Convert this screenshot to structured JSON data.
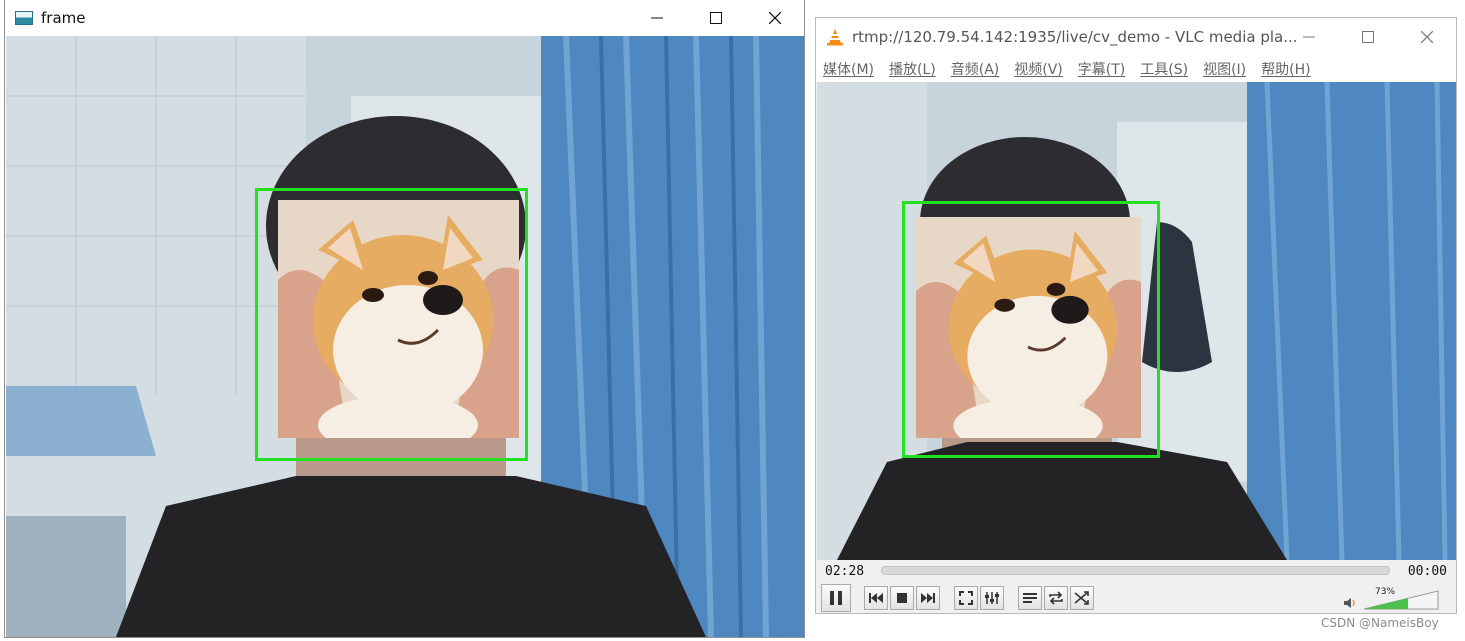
{
  "windows": {
    "frame": {
      "title": "frame"
    },
    "vlc": {
      "title": "rtmp://120.79.54.142:1935/live/cv_demo - VLC media pla...",
      "menu": [
        "媒体(M)",
        "播放(L)",
        "音频(A)",
        "视频(V)",
        "字幕(T)",
        "工具(S)",
        "视图(I)",
        "帮助(H)"
      ],
      "time_elapsed": "02:28",
      "time_total": "00:00",
      "volume": "73%"
    }
  },
  "watermark": "CSDN @NameisBoy",
  "colors": {
    "face_box": "#22e022",
    "curtain": "#4f88c0"
  },
  "icons": {
    "window_controls": [
      "minimize-icon",
      "maximize-icon",
      "close-icon"
    ],
    "vlc_controls": [
      "pause-icon",
      "previous-icon",
      "stop-icon",
      "next-icon",
      "fullscreen-icon",
      "extended-settings-icon",
      "playlist-icon",
      "loop-icon",
      "shuffle-icon",
      "volume-icon"
    ]
  }
}
